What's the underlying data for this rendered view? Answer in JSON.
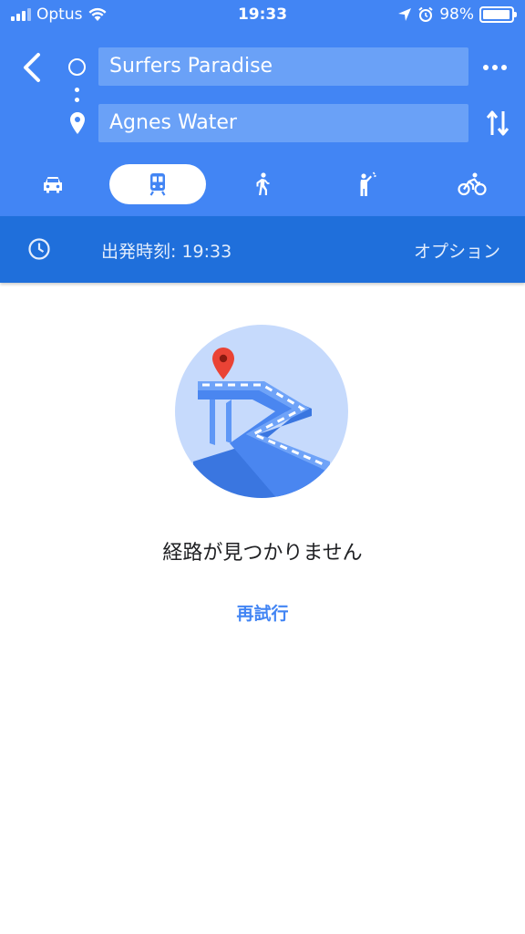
{
  "status_bar": {
    "carrier": "Optus",
    "time": "19:33",
    "battery": "98%",
    "battery_level": 0.98
  },
  "search": {
    "origin": "Surfers Paradise",
    "destination": "Agnes Water"
  },
  "travel_modes": [
    {
      "id": "drive",
      "icon": "car-icon",
      "selected": false
    },
    {
      "id": "transit",
      "icon": "train-icon",
      "selected": true
    },
    {
      "id": "walk",
      "icon": "walk-icon",
      "selected": false
    },
    {
      "id": "ride",
      "icon": "hail-icon",
      "selected": false
    },
    {
      "id": "bike",
      "icon": "bike-icon",
      "selected": false
    }
  ],
  "depart": {
    "label": "出発時刻: 19:33",
    "options": "オプション"
  },
  "result": {
    "message": "経路が見つかりません",
    "retry": "再試行"
  },
  "colors": {
    "header": "#4285f4",
    "depart_bar": "#1f6fdb",
    "accent": "#4285f4",
    "pin": "#ea4335"
  }
}
